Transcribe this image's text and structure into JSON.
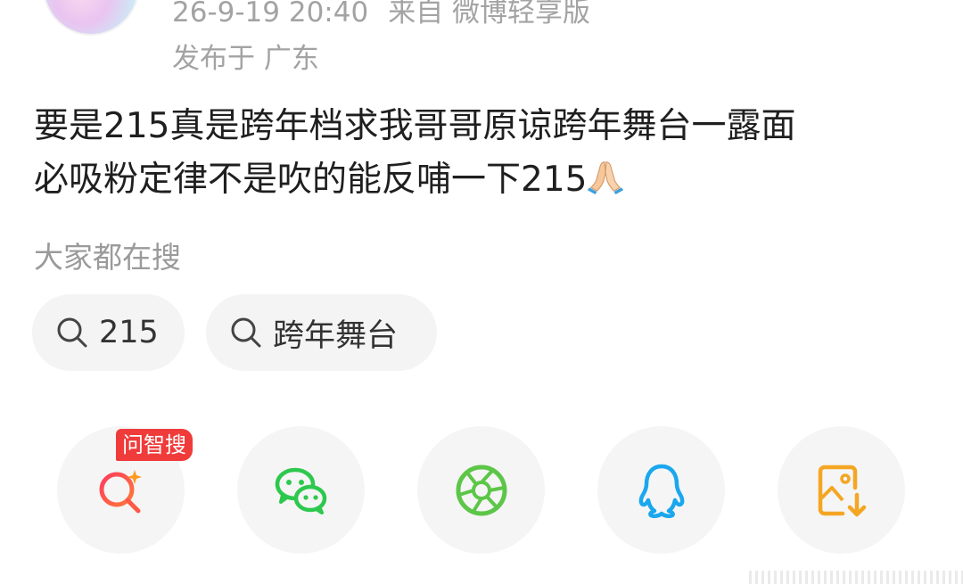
{
  "post": {
    "timestamp": "26-9-19 20:40",
    "source": "来自 微博轻享版",
    "location": "发布于 广东",
    "text_line1": "要是215真是跨年档求我哥哥原谅跨年舞台一露面",
    "text_line2": "必吸粉定律不是吹的能反哺一下215",
    "text_emoji": "folded-hands-emoji"
  },
  "search_section": {
    "heading": "大家都在搜",
    "items": [
      {
        "label": "215",
        "icon": "search-icon"
      },
      {
        "label": "跨年舞台",
        "icon": "search-icon"
      }
    ]
  },
  "share_bar": {
    "buttons": [
      {
        "name": "wenzhisou-search",
        "icon": "ai-search-icon",
        "badge": "问智搜",
        "color": "#f0404a"
      },
      {
        "name": "wechat",
        "icon": "wechat-icon",
        "color": "#2dc84d"
      },
      {
        "name": "moments",
        "icon": "camera-shutter-icon",
        "color": "#5cc648"
      },
      {
        "name": "qq",
        "icon": "qq-penguin-icon",
        "color": "#1aa7ee"
      },
      {
        "name": "save-image",
        "icon": "save-image-icon",
        "color": "#f4a623"
      }
    ]
  }
}
